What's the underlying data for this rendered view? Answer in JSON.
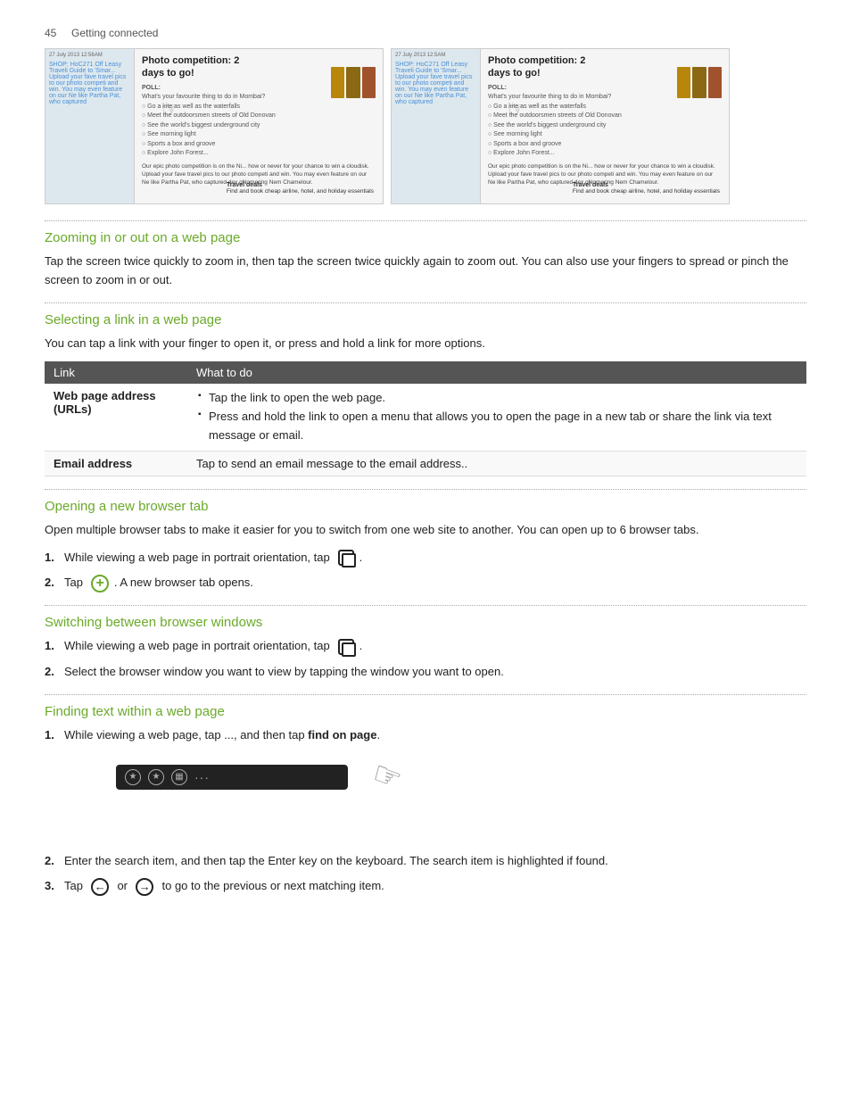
{
  "page": {
    "page_number": "45",
    "page_label": "Getting connected"
  },
  "sections": {
    "zooming": {
      "heading": "Zooming in or out on a web page",
      "text": "Tap the screen twice quickly to zoom in, then tap the screen twice quickly again to zoom out. You can also use your fingers to spread or pinch the screen to zoom in or out."
    },
    "selecting_link": {
      "heading": "Selecting a link in a web page",
      "text": "You can tap a link with your finger to open it, or press and hold a link for more options.",
      "table": {
        "col1": "Link",
        "col2": "What to do",
        "rows": [
          {
            "link_type": "Web page address (URLs)",
            "actions": [
              "Tap the link to open the web page.",
              "Press and hold the link to open a menu that allows you to open the page in a new tab or share the link via text message or email."
            ]
          },
          {
            "link_type": "Email address",
            "actions": [
              "Tap to send an email message to the email address.."
            ]
          }
        ]
      }
    },
    "opening_tab": {
      "heading": "Opening a new browser tab",
      "intro": "Open multiple browser tabs to make it easier for you to switch from one web site to another. You can open up to 6 browser tabs.",
      "steps": [
        "While viewing a web page in portrait orientation, tap",
        "Tap . A new browser tab opens."
      ],
      "step2_prefix": "Tap",
      "step2_suffix": ". A new browser tab opens."
    },
    "switching": {
      "heading": "Switching between browser windows",
      "steps": [
        "While viewing a web page in portrait orientation, tap",
        "Select the browser window you want to view by tapping the window you want to open."
      ]
    },
    "finding": {
      "heading": "Finding text within a web page",
      "steps": [
        {
          "text_before": "While viewing a web page, tap ..., and then tap",
          "bold": "find on page",
          "text_after": "."
        },
        "Enter the search item, and then tap the Enter key on the keyboard. The search item is highlighted if found.",
        {
          "text_before": "Tap",
          "icon1": "←",
          "text_mid": "or",
          "icon2": "→",
          "text_after": "to go to the previous or next matching item."
        }
      ],
      "find_bar_label": "find on page"
    }
  }
}
